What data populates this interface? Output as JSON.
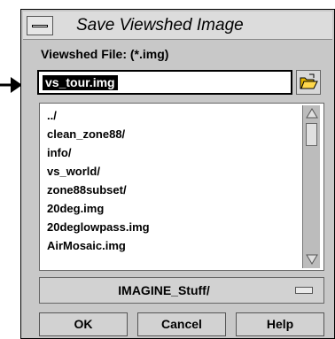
{
  "window": {
    "title": "Save Viewshed Image"
  },
  "file": {
    "label": "Viewshed File: (*.img)",
    "value": "vs_tour.img"
  },
  "list": {
    "items": [
      "../",
      "clean_zone88/",
      "info/",
      "vs_world/",
      "zone88subset/",
      "20deg.img",
      "20deglowpass.img",
      "AirMosaic.img"
    ]
  },
  "directory": {
    "label": "IMAGINE_Stuff/"
  },
  "buttons": {
    "ok": "OK",
    "cancel": "Cancel",
    "help": "Help"
  },
  "icons": {
    "window_menu": "window-menu-icon",
    "open_folder": "open-folder-icon",
    "pointer": "arrow-pointer-icon",
    "option_menu": "option-menu-indicator-icon"
  }
}
